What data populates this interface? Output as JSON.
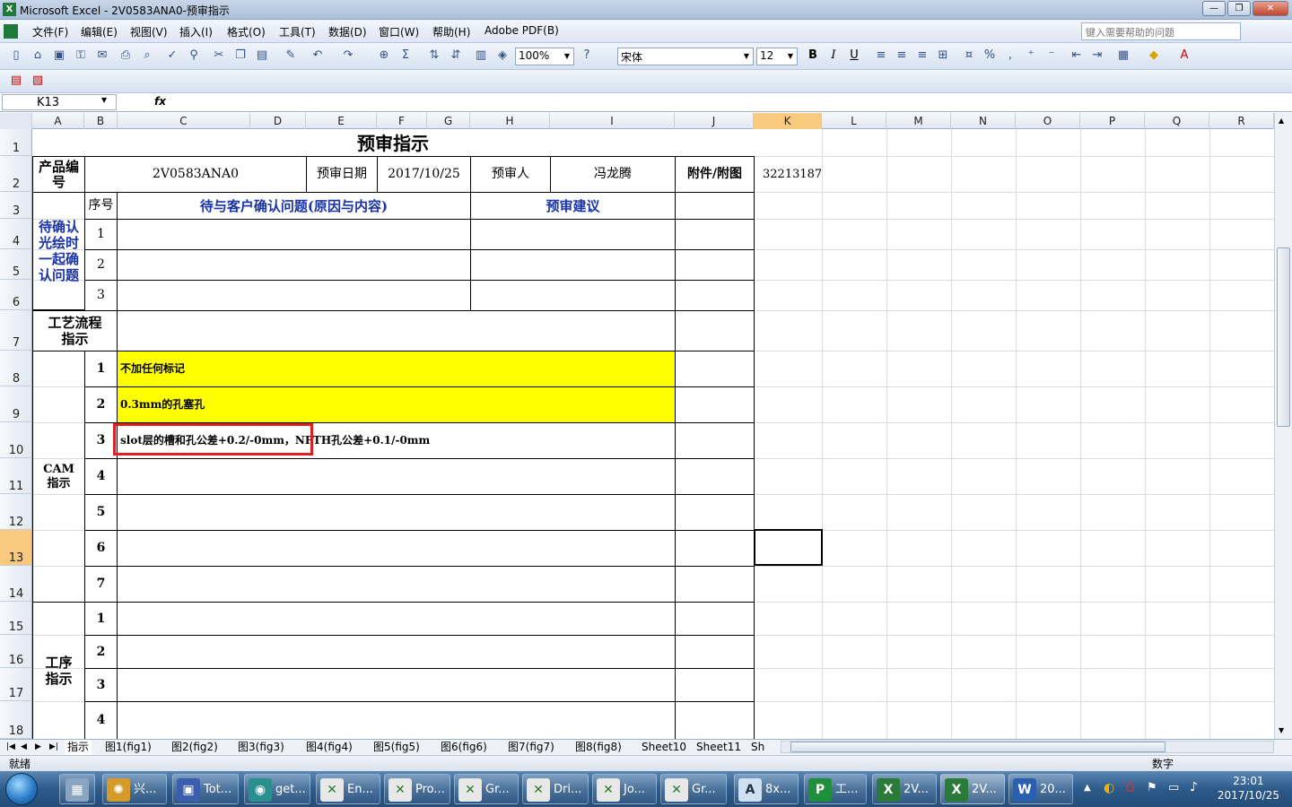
{
  "window": {
    "title": "Microsoft Excel - 2V0583ANA0-预审指示",
    "logo": "X",
    "minimize": "—",
    "restore": "❐",
    "close": "✕"
  },
  "menu": [
    "文件(F)",
    "编辑(E)",
    "视图(V)",
    "插入(I)",
    "格式(O)",
    "工具(T)",
    "数据(D)",
    "窗口(W)",
    "帮助(H)",
    "Adobe PDF(B)"
  ],
  "help_placeholder": "键入需要帮助的问题",
  "toolbar": {
    "zoom": "100%",
    "font": "宋体",
    "size": "12",
    "bold": "B",
    "italic": "I",
    "underline": "U",
    "percent": "%",
    "comma": ","
  },
  "formula_bar": {
    "name_box": "K13",
    "fx": "fx",
    "formula": ""
  },
  "columns": [
    "A",
    "B",
    "C",
    "D",
    "E",
    "F",
    "G",
    "H",
    "I",
    "J",
    "K",
    "L",
    "M",
    "N",
    "O",
    "P",
    "Q",
    "R"
  ],
  "rows": [
    "1",
    "2",
    "3",
    "4",
    "5",
    "6",
    "7",
    "8",
    "9",
    "10",
    "11",
    "12",
    "13",
    "14",
    "15",
    "16",
    "17",
    "18"
  ],
  "sheet": {
    "title": "预审指示",
    "product_label": "产品编号",
    "product_no": "2V0583ANA0",
    "date_label": "预审日期",
    "date": "2017/10/25",
    "reviewer_label": "预审人",
    "reviewer": "冯龙腾",
    "attach_label": "附件/附图",
    "attach_value": "32213187",
    "seq_label": "序号",
    "issue_header": "待与客户确认问题(原因与内容)",
    "advice_header": "预审建议",
    "confirm_label": "待确认光绘时一起确认问题",
    "process_label": "工艺流程指示",
    "cam_label": "CAM指示",
    "op_label": "工序指示",
    "confirm_nums": [
      "1",
      "2",
      "3"
    ],
    "cam_nums": [
      "1",
      "2",
      "3",
      "4",
      "5",
      "6",
      "7"
    ],
    "op_nums": [
      "1",
      "2",
      "3",
      "4"
    ],
    "cam_items": [
      "不加任何标记",
      "0.3mm的孔塞孔",
      "slot层的槽和孔公差+0.2/-0mm，NPTH孔公差+0.1/-0mm"
    ]
  },
  "tabs": [
    "指示",
    "图1(fig1)",
    "图2(fig2)",
    "图3(fig3)",
    "图4(fig4)",
    "图5(fig5)",
    "图6(fig6)",
    "图7(fig7)",
    "图8(fig8)",
    "Sheet10",
    "Sheet11",
    "Sh"
  ],
  "status": {
    "left": "就绪",
    "right": "数字"
  },
  "taskbar": {
    "items": [
      "兴...",
      "Tot...",
      "get...",
      "En...",
      "Pro...",
      "Gr...",
      "Dri...",
      "Jo...",
      "Gr...",
      "8x...",
      "工...",
      "2V...",
      "2V...",
      "20..."
    ],
    "time": "23:01",
    "date": "2017/10/25"
  },
  "colors": {
    "yellow": "#ffff00",
    "blue_text": "#1a33a6",
    "annotation": "#e0201f"
  }
}
